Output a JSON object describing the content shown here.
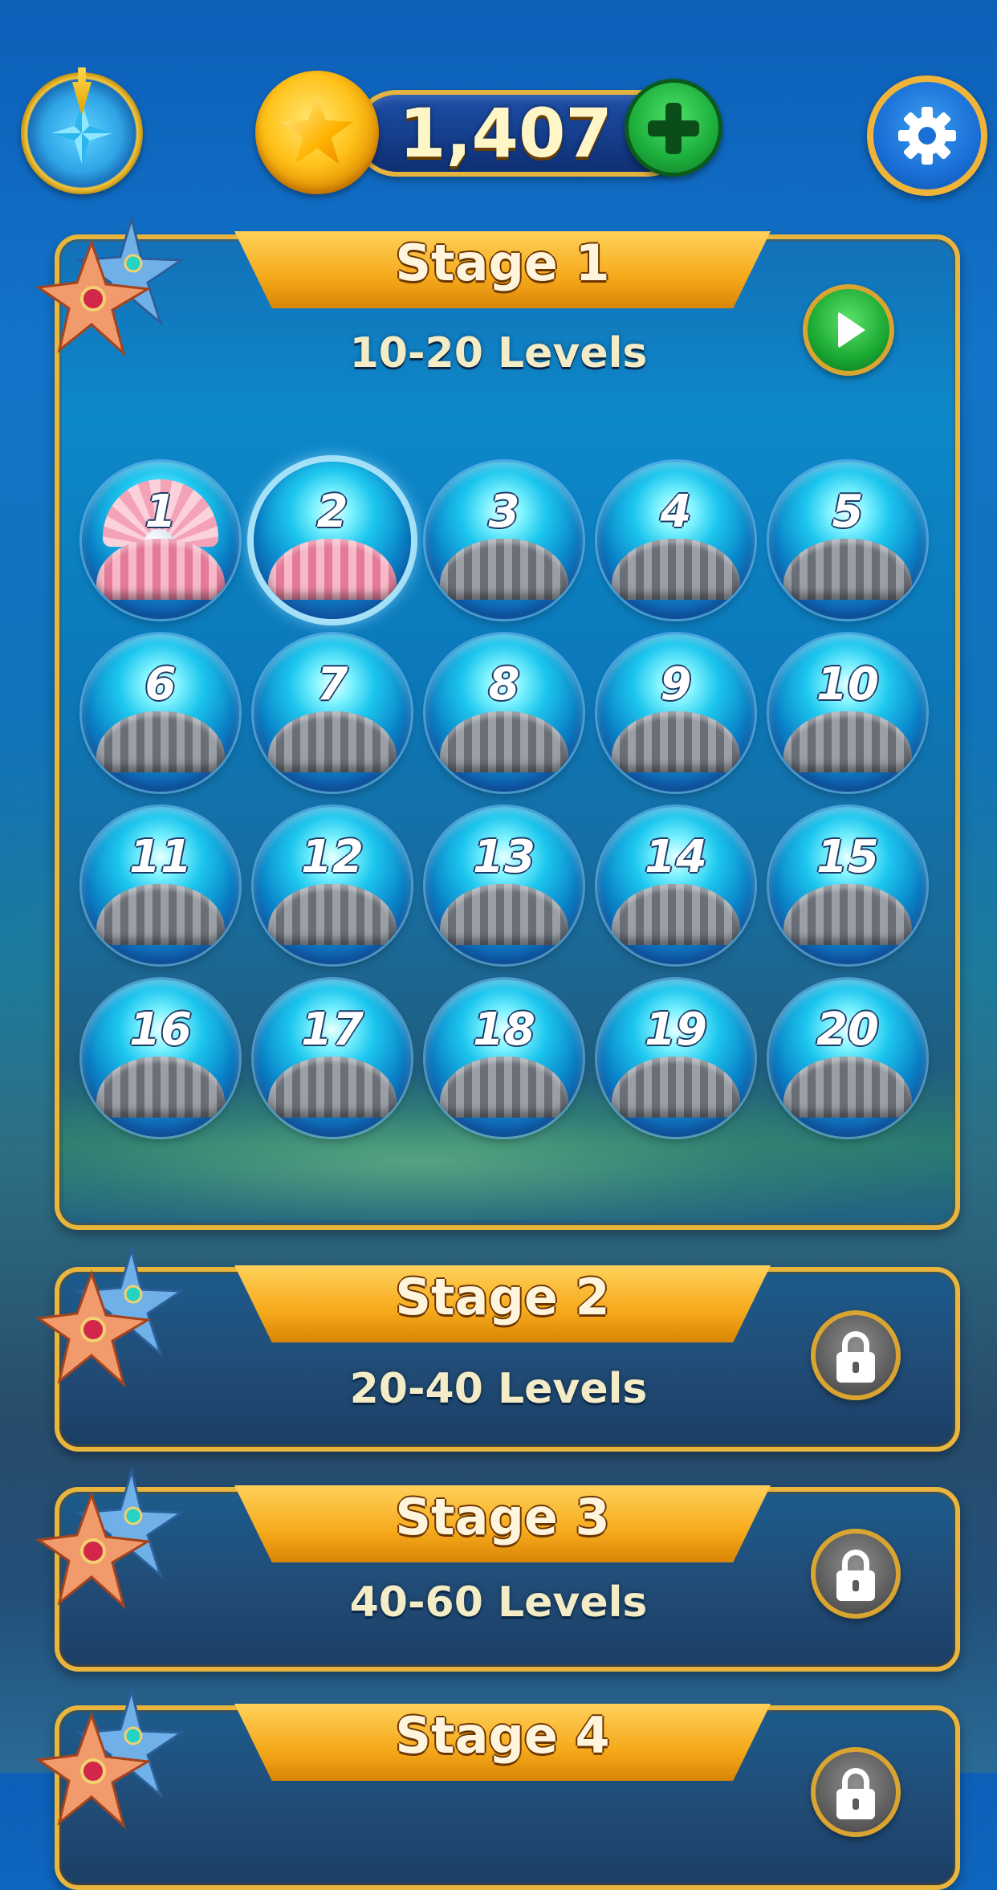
{
  "top_bar": {
    "coins": "1,407",
    "compass_icon": "compass-icon",
    "coin_icon": "gold-star-coin-icon",
    "add_coins_icon": "plus-icon",
    "settings_icon": "gear-icon"
  },
  "stages": [
    {
      "title": "Stage 1",
      "levels_label": "10-20 Levels",
      "status": "unlocked",
      "action_icon": "play-icon"
    },
    {
      "title": "Stage 2",
      "levels_label": "20-40 Levels",
      "status": "locked",
      "action_icon": "lock-icon"
    },
    {
      "title": "Stage 3",
      "levels_label": "40-60 Levels",
      "status": "locked",
      "action_icon": "lock-icon"
    },
    {
      "title": "Stage 4",
      "levels_label": "",
      "status": "locked",
      "action_icon": "lock-icon"
    }
  ],
  "levels": [
    {
      "number": "1",
      "state": "completed-pearl"
    },
    {
      "number": "2",
      "state": "current"
    },
    {
      "number": "3",
      "state": "locked"
    },
    {
      "number": "4",
      "state": "locked"
    },
    {
      "number": "5",
      "state": "locked"
    },
    {
      "number": "6",
      "state": "locked"
    },
    {
      "number": "7",
      "state": "locked"
    },
    {
      "number": "8",
      "state": "locked"
    },
    {
      "number": "9",
      "state": "locked"
    },
    {
      "number": "10",
      "state": "locked"
    },
    {
      "number": "11",
      "state": "locked"
    },
    {
      "number": "12",
      "state": "locked"
    },
    {
      "number": "13",
      "state": "locked"
    },
    {
      "number": "14",
      "state": "locked"
    },
    {
      "number": "15",
      "state": "locked"
    },
    {
      "number": "16",
      "state": "locked"
    },
    {
      "number": "17",
      "state": "locked"
    },
    {
      "number": "18",
      "state": "locked"
    },
    {
      "number": "19",
      "state": "locked"
    },
    {
      "number": "20",
      "state": "locked"
    }
  ],
  "colors": {
    "gold": "#e9b53c",
    "ocean": "#0d78c0",
    "play_green": "#1aa832",
    "lock_gray": "#5b5b5b"
  }
}
